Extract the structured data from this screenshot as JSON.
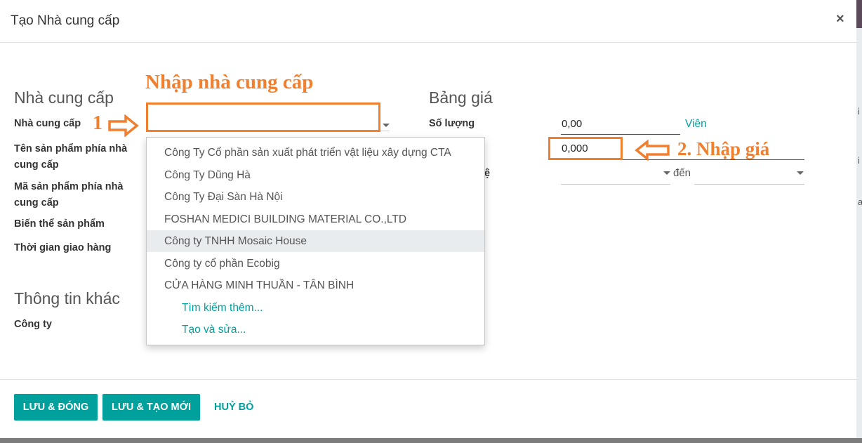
{
  "dialog": {
    "title": "Tạo Nhà cung cấp",
    "close": "×"
  },
  "vendor_section": {
    "title": "Nhà cung cấp",
    "fields": {
      "vendor": "Nhà cung cấp",
      "vendor_product_name_l1": "Tên sản phẩm phía nhà",
      "vendor_product_name_l2": "cung cấp",
      "vendor_product_code_l1": "Mã sản phẩm phía nhà",
      "vendor_product_code_l2": "cung cấp",
      "variant": "Biến thể sản phẩm",
      "lead_time": "Thời gian giao hàng"
    }
  },
  "other_section": {
    "title": "Thông tin khác",
    "company": "Công ty"
  },
  "pricelist_section": {
    "title": "Bảng giá",
    "quantity_label": "Số lượng",
    "quantity_value": "0,00",
    "unit": "Viên",
    "price_value": "0,000",
    "validity_label_fragment": "ệ",
    "to_label": "đến"
  },
  "vendor_dropdown": {
    "items": [
      "Công Ty Cổ phần sản xuất phát triển vật liệu xây dựng CTA",
      "Công Ty Dũng Hà",
      "Công Ty Đại Sàn Hà Nội",
      "FOSHAN MEDICI BUILDING MATERIAL CO.,LTD",
      "Công ty TNHH Mosaic House",
      "Công ty cổ phần Ecobig",
      "CỬA HÀNG MINH THUẦN - TÂN BÌNH"
    ],
    "search_more": "Tìm kiếm thêm...",
    "create_edit": "Tạo và sửa..."
  },
  "annotations": {
    "enter_vendor": "Nhập nhà cung cấp",
    "step1": "1",
    "step2": "2. Nhập giá",
    "color": "#f08030"
  },
  "footer": {
    "save_close": "LƯU & ĐÓNG",
    "save_new": "LƯU & TẠO MỚI",
    "cancel": "HUỶ BỎ"
  },
  "background_edge": {
    "t1": "i",
    "t2": "i",
    "t3": "a"
  },
  "colors": {
    "accent": "#00A09D"
  }
}
